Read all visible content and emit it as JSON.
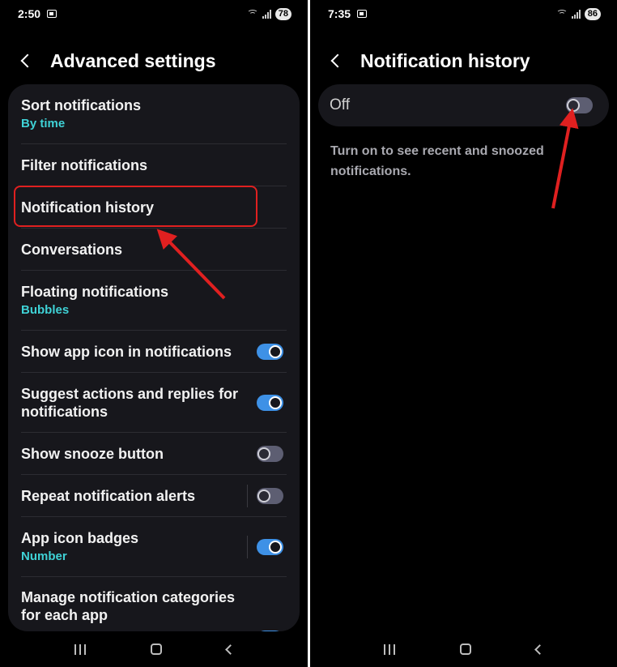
{
  "left": {
    "status": {
      "time": "2:50",
      "battery": "78"
    },
    "header": {
      "title": "Advanced settings"
    },
    "settings": [
      {
        "title": "Sort notifications",
        "subtitle": "By time"
      },
      {
        "title": "Filter notifications"
      },
      {
        "title": "Notification history"
      },
      {
        "title": "Conversations"
      },
      {
        "title": "Floating notifications",
        "subtitle": "Bubbles"
      },
      {
        "title": "Show app icon in notifications",
        "toggle": true
      },
      {
        "title": "Suggest actions and replies for",
        "title2": "notifications",
        "toggle": true
      },
      {
        "title": "Show snooze button",
        "toggle": false
      },
      {
        "title": "Repeat notification alerts",
        "toggle": false
      },
      {
        "title": "App icon badges",
        "subtitle": "Number",
        "toggle": true
      },
      {
        "title": "Manage notification categories",
        "title2": "for each app",
        "toggle": true
      }
    ]
  },
  "right": {
    "status": {
      "time": "7:35",
      "battery": "86"
    },
    "header": {
      "title": "Notification history"
    },
    "history": {
      "toggle_label": "Off",
      "toggle_on": false,
      "description_line1": "Turn on to see recent and snoozed",
      "description_line2": "notifications."
    }
  },
  "colors": {
    "background": "#000000",
    "card": "#17171c",
    "accent_subtitle": "#3fd2d6",
    "toggle_on": "#3e91e6",
    "toggle_off": "#5d5e72",
    "annotation_red": "#e02020"
  },
  "icons": [
    "back-icon",
    "screenshot-icon",
    "wifi-icon",
    "signal-icon",
    "recent-apps-icon",
    "home-icon",
    "nav-back-icon"
  ]
}
